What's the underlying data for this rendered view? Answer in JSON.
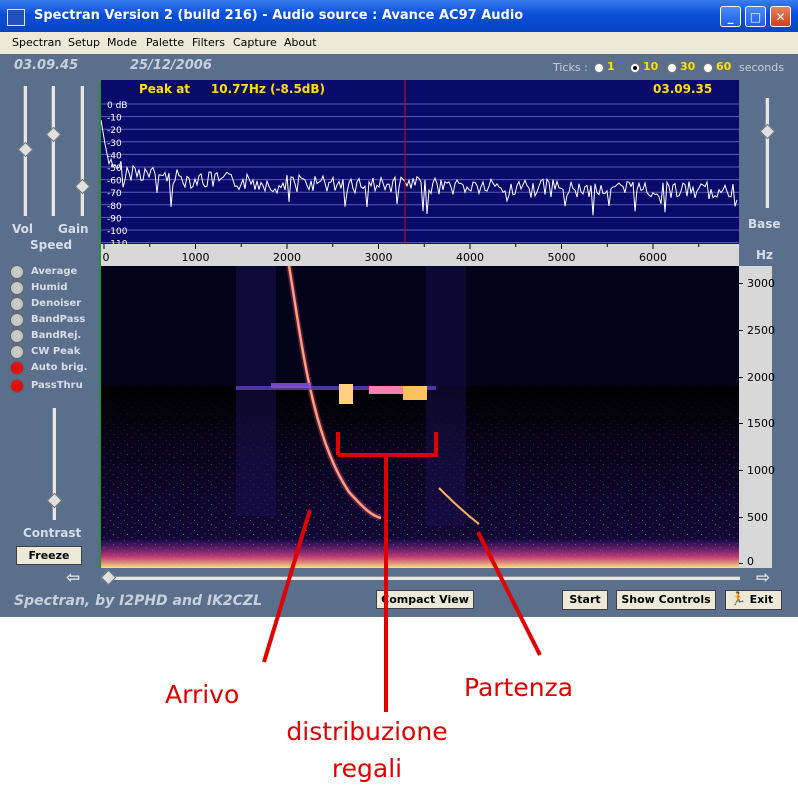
{
  "window": {
    "title": "Spectran Version 2 (build 216) - Audio source  :  Avance AC97 Audio",
    "minimize_glyph": "_",
    "maximize_glyph": "□",
    "close_glyph": "✕"
  },
  "menu": [
    "Spectran",
    "Setup",
    "Mode",
    "Palette",
    "Filters",
    "Capture",
    "About"
  ],
  "header": {
    "time": "03.09.45",
    "date": "25/12/2006",
    "ticks_label": "Ticks :",
    "ticks_options": [
      "1",
      "10",
      "30",
      "60"
    ],
    "ticks_selected": "10",
    "ticks_unit": "seconds"
  },
  "left_panel": {
    "vol_label": "Vol",
    "gain_label": "Gain",
    "speed_label": "Speed",
    "options": [
      {
        "label": "Average",
        "on": false
      },
      {
        "label": "Humid",
        "on": false
      },
      {
        "label": "Denoiser",
        "on": false
      },
      {
        "label": "BandPass",
        "on": false
      },
      {
        "label": "BandRej.",
        "on": false
      },
      {
        "label": "CW Peak",
        "on": false
      },
      {
        "label": "Auto brig.",
        "on": true
      },
      {
        "label": "PassThru",
        "on": true
      }
    ],
    "contrast_label": "Contrast",
    "freeze_label": "Freeze"
  },
  "right_panel": {
    "base_label": "Base",
    "hz_label": "Hz"
  },
  "spectrum": {
    "peak_text": "Peak at     10.77Hz (-8.5dB)",
    "time_text": "03.09.35",
    "db_labels": [
      "0 dB",
      "-10",
      "-20",
      "-30",
      "-40",
      "-50",
      "-60",
      "-70",
      "-80",
      "-90",
      "-100",
      "-110"
    ],
    "freq_labels": [
      "0",
      "1000",
      "2000",
      "3000",
      "4000",
      "5000",
      "6000"
    ],
    "colors": {
      "background": "#0a0a6a",
      "trace": "#ffffff",
      "grid": "#5a5ab8",
      "cursor": "#c01010",
      "peak_text": "#ffe000"
    }
  },
  "waterfall": {
    "hz_labels": [
      "3000",
      "2500",
      "2000",
      "1500",
      "1000",
      "500",
      "0"
    ]
  },
  "footer": {
    "credit": "Spectran, by I2PHD and IK2CZL",
    "compact_view": "Compact View",
    "start": "Start",
    "show_controls": "Show Controls",
    "exit": "Exit",
    "left_arrow": "⇦",
    "right_arrow": "⇨"
  },
  "annotations": {
    "arrivo": "Arrivo",
    "distribuzione_line1": "distribuzione",
    "distribuzione_line2": "regali",
    "partenza": "Partenza",
    "color": "#e00000"
  }
}
